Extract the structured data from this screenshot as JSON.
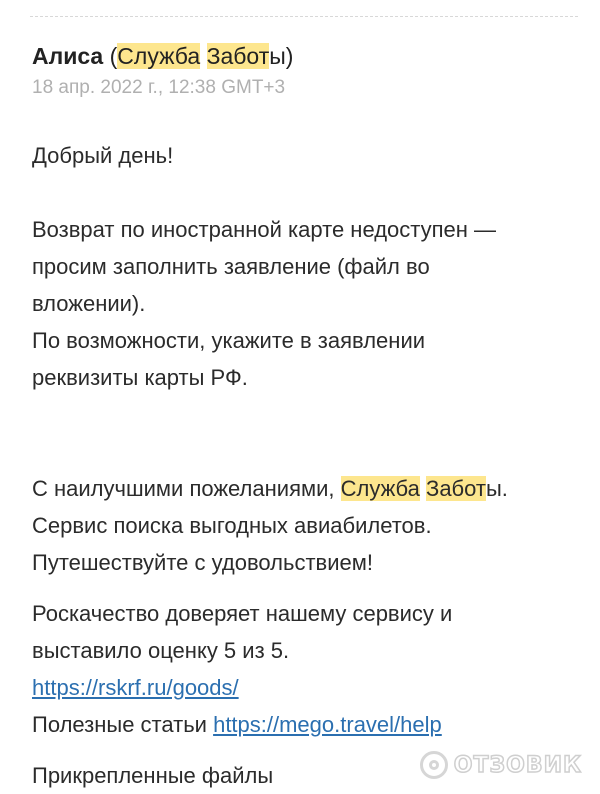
{
  "header": {
    "sender_name": "Алиса",
    "org_open": "(",
    "org_word1": "Служба",
    "org_space": " ",
    "org_word2_hl": "Забот",
    "org_tail": "ы)",
    "date": "18 апр. 2022 г., 12:38 GMT+3"
  },
  "message": {
    "greeting": "Добрый день!",
    "para1": [
      "Возврат по иностранной карте недоступен —",
      "просим заполнить заявление (файл во",
      "вложении).",
      "По возможности, укажите в заявлении",
      "реквизиты карты РФ."
    ],
    "sign_prefix": "С наилучшими пожеланиями, ",
    "sign_word1": "Служба",
    "sign_space": " ",
    "sign_word2_hl": "Забот",
    "sign_tail": "ы.",
    "sign_line2": "Сервис поиска выгодных авиабилетов.",
    "sign_line3": "Путешествуйте с удовольствием!",
    "rating_line1": "Роскачество доверяет нашему сервису и",
    "rating_line2": "выставило оценку 5 из 5.",
    "rating_link": "https://rskrf.ru/goods/",
    "articles_label": "Полезные статьи ",
    "articles_link": "https://mego.travel/help",
    "attachments_heading": "Прикрепленные файлы"
  },
  "watermark": {
    "text": "ОТЗОВИК",
    "icon": "otzovik-logo-icon"
  },
  "colors": {
    "highlight": "#fde68e",
    "link": "#2b6fb0",
    "date": "#b0b0b0"
  }
}
